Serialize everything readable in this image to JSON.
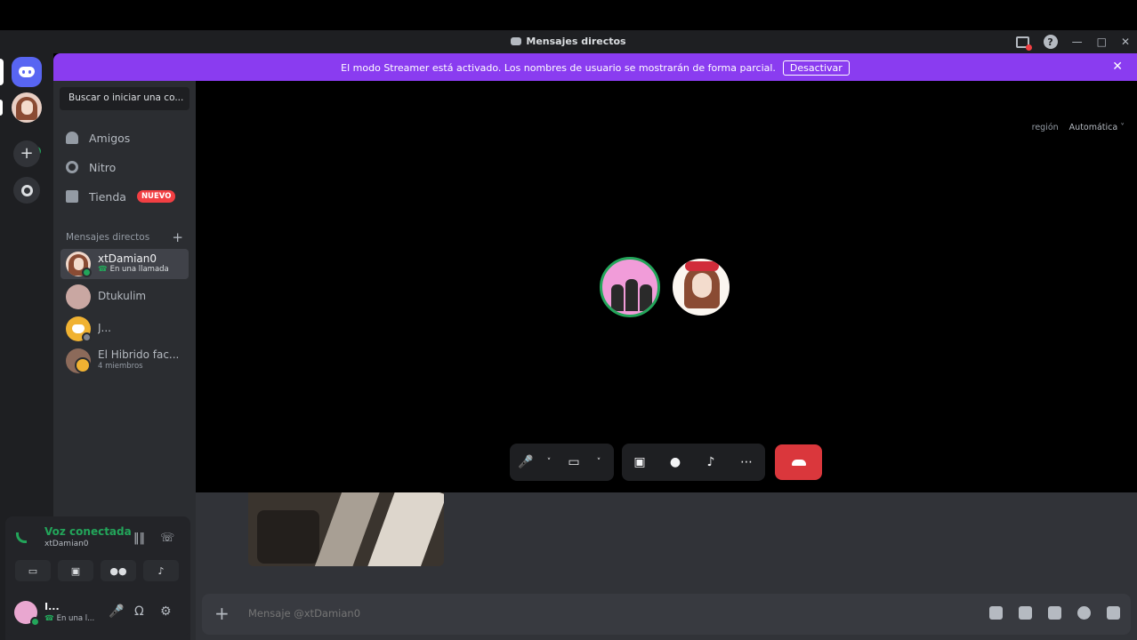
{
  "window": {
    "title": "Mensajes directos"
  },
  "banner": {
    "message": "El modo Streamer está activado. Los nombres de usuario se mostrarán de forma parcial.",
    "button_label": "Desactivar",
    "color": "#8a3cf0"
  },
  "sidebar": {
    "search_label": "Buscar o iniciar una co...",
    "nav": [
      {
        "label": "Amigos",
        "icon": "friends-icon"
      },
      {
        "label": "Nitro",
        "icon": "nitro-icon"
      },
      {
        "label": "Tienda",
        "icon": "shop-icon",
        "badge": "NUEVO"
      }
    ],
    "dm_header": "Mensajes directos",
    "dms": [
      {
        "name": "xtDamian0",
        "status": "En una llamada",
        "active": true
      },
      {
        "name": "Dtukulim"
      },
      {
        "name": "J..."
      },
      {
        "name": "El Hibrido fac...",
        "sub": "4 miembros"
      }
    ]
  },
  "voice": {
    "title": "Voz conectada",
    "channel": "xtDamian0"
  },
  "user": {
    "name": "I...",
    "status": "En una l..."
  },
  "call": {
    "region_label": "región",
    "region_value": "Automática"
  },
  "chat": {
    "placeholder": "Mensaje @xtDamian0"
  },
  "colors": {
    "online": "#23a55a",
    "danger": "#da373c",
    "brand": "#5865f2"
  }
}
